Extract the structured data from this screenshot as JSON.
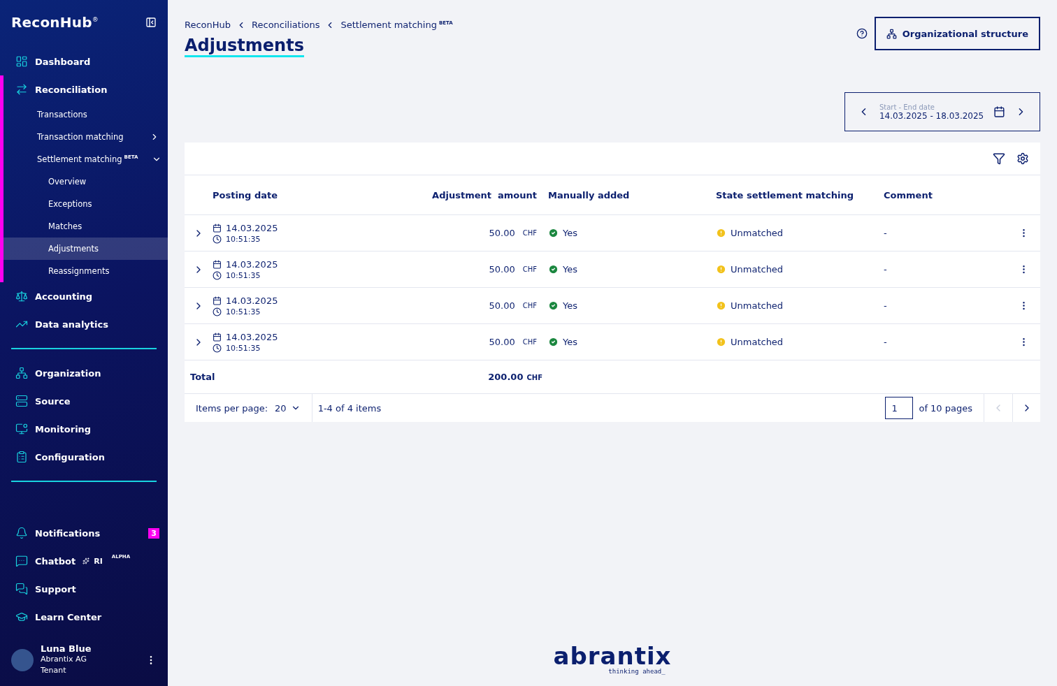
{
  "sidebar": {
    "logo": "ReconHub",
    "logo_mark": "®",
    "main_nav": [
      {
        "label": "Dashboard",
        "selected": false
      },
      {
        "label": "Reconciliation",
        "selected": true,
        "children": [
          {
            "label": "Transactions",
            "selected": false
          },
          {
            "label": "Transaction matching",
            "selected": false,
            "expanded": false
          },
          {
            "label": "Settlement matching",
            "badge": "BETA",
            "selected": false,
            "expanded": true,
            "children": [
              {
                "label": "Overview",
                "selected": false
              },
              {
                "label": "Exceptions",
                "selected": false
              },
              {
                "label": "Matches",
                "selected": false
              },
              {
                "label": "Adjustments",
                "selected": true
              },
              {
                "label": "Reassignments",
                "selected": false
              }
            ]
          }
        ]
      },
      {
        "label": "Accounting",
        "selected": false
      },
      {
        "label": "Data analytics",
        "selected": false
      }
    ],
    "admin_nav": [
      {
        "label": "Organization",
        "selected": false
      },
      {
        "label": "Source",
        "selected": false
      },
      {
        "label": "Monitoring",
        "selected": false
      },
      {
        "label": "Configuration",
        "selected": false
      }
    ],
    "help_nav": [
      {
        "label": "Notifications",
        "selected": false,
        "count": "3"
      },
      {
        "label": "Chatbot",
        "selected": false,
        "ai_mark": "RI",
        "badge": "ALPHA"
      },
      {
        "label": "Support",
        "selected": false
      },
      {
        "label": "Learn Center",
        "selected": false
      }
    ],
    "user": {
      "name": "Luna Blue",
      "organization": "Abrantix AG",
      "role": "Tenant"
    }
  },
  "header": {
    "breadcrumbs": [
      {
        "label": "ReconHub"
      },
      {
        "label": "Reconciliations"
      },
      {
        "label": "Settlement matching",
        "badge": "BETA"
      }
    ],
    "title": "Adjustments",
    "org_button": "Organizational structure",
    "date_range": {
      "label": "Start - End date",
      "value": "14.03.2025 - 18.03.2025"
    }
  },
  "table": {
    "columns": [
      "Posting date",
      "Adjustment  amount",
      "Manually added",
      "State settlement matching",
      "Comment"
    ],
    "rows": [
      {
        "date": "14.03.2025",
        "time": "10:51:35",
        "amount": "50.00",
        "currency": "CHF",
        "manually_added": "Yes",
        "state": "Unmatched",
        "comment": "-",
        "expanded": false
      },
      {
        "date": "14.03.2025",
        "time": "10:51:35",
        "amount": "50.00",
        "currency": "CHF",
        "manually_added": "Yes",
        "state": "Unmatched",
        "comment": "-",
        "expanded": false
      },
      {
        "date": "14.03.2025",
        "time": "10:51:35",
        "amount": "50.00",
        "currency": "CHF",
        "manually_added": "Yes",
        "state": "Unmatched",
        "comment": "-",
        "expanded": false
      },
      {
        "date": "14.03.2025",
        "time": "10:51:35",
        "amount": "50.00",
        "currency": "CHF",
        "manually_added": "Yes",
        "state": "Unmatched",
        "comment": "-",
        "expanded": false
      }
    ],
    "total": {
      "label": "Total",
      "amount": "200.00",
      "currency": "CHF"
    },
    "pagination": {
      "per_page_label": "Items per page:",
      "per_page": "20",
      "range": "1-4 of 4 items",
      "page": "1",
      "pages_label": "of 10 pages",
      "prev_disabled": true,
      "next_disabled": false
    }
  },
  "footer": {
    "brand": "abrantix",
    "tagline": "thinking ahead_"
  }
}
